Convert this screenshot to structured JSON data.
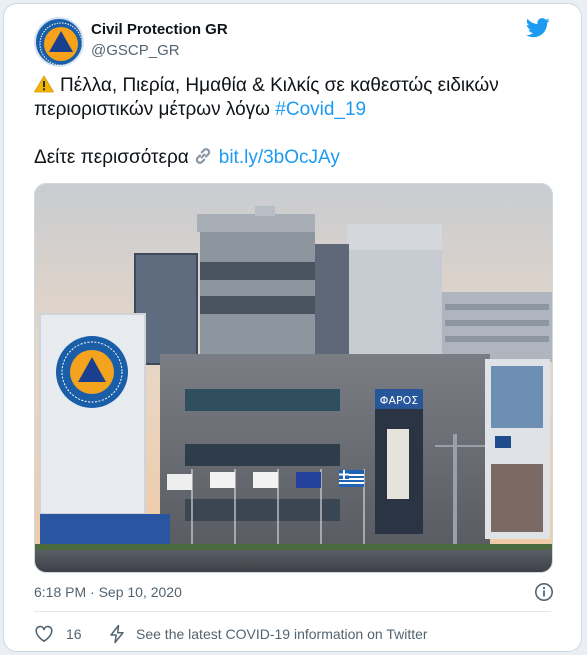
{
  "author": {
    "name": "Civil Protection GR",
    "handle": "@GSCP_GR",
    "avatar_label": "ΠΟΛΙΤΙΚΗ ΠΡΟΣΤΑΣΙΑ ΕΛΛΑΔΑ"
  },
  "tweet": {
    "line1": "Πέλλα, Πιερία, Ημαθία & Κιλκίς σε καθεστώς ειδικών",
    "line2_text": "περιοριστικών μέτρων λόγω ",
    "hashtag": "#Covid_19",
    "more_label": "Δείτε περισσότερα",
    "link": "bit.ly/3bOcJAy"
  },
  "media": {
    "building_sign": "ΦΑΡΟΣ",
    "emblem_text": "ΠΟΛΙΤΙΚΗ ΠΡΟΣΤΑΣΙΑ ΕΛΛΑΔΑ"
  },
  "meta": {
    "timestamp": "6:18 PM · Sep 10, 2020"
  },
  "footer": {
    "like_count": "16",
    "covid_info": "See the latest COVID-19 information on Twitter"
  },
  "colors": {
    "link": "#1d9bf0",
    "twitter_blue": "#1d9bf0",
    "muted": "#536471"
  },
  "icons": [
    "twitter-bird-icon",
    "warning-icon",
    "link-icon",
    "info-icon",
    "heart-icon",
    "flash-icon"
  ]
}
